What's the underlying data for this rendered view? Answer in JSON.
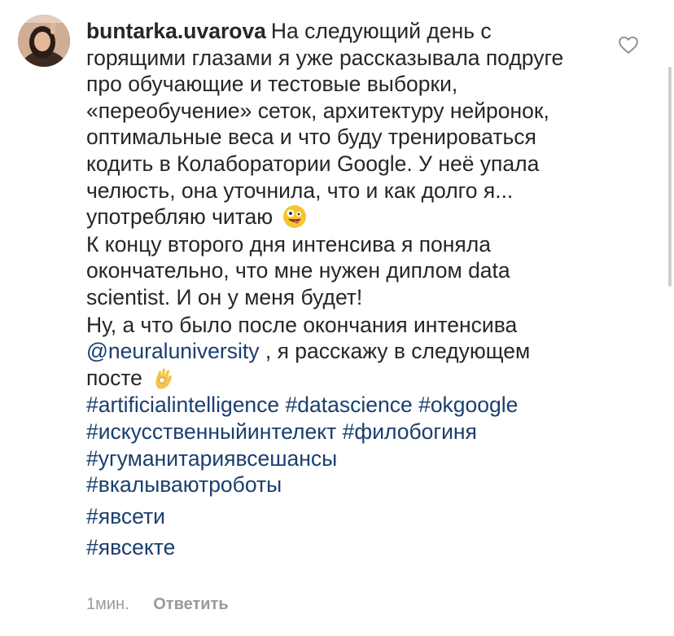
{
  "comment": {
    "username": "buntarka.uvarova",
    "paragraph1": "На следующий день с горящими глазами я уже рассказывала подруге про обучающие и тестовые выборки, «переобучение» сеток, архитектуру нейронок, оптимальные веса и что буду тренироваться кодить в Колаборатории Google.  У неё упала челюсть, она уточнила, что и как долго я... употребляю читаю",
    "paragraph1_emoji": "zany-face-emoji",
    "paragraph2": "К концу второго дня интенсива я поняла окончательно, что мне нужен диплом data scientist. И он у меня будет!",
    "paragraph3_before": "Ну, а что было после окончания интенсива",
    "mention": "@neuraluniversity",
    "paragraph3_after": " , я расскажу в следующем посте",
    "paragraph3_emoji": "ok-hand-emoji",
    "hashtags": [
      "#artificialintelligence",
      "#datascience",
      "#okgoogle",
      "#искусственныйинтелект",
      "#филобогиня",
      "#угуманитариявсешансы",
      "#вкалываютроботы",
      "#явсети",
      "#явсекте"
    ]
  },
  "footer": {
    "time": "1мин.",
    "reply_label": "Ответить"
  },
  "icons": {
    "like": "heart-outline-icon"
  },
  "colors": {
    "text": "#262626",
    "link": "#1a3f6e",
    "muted": "#9a9a9a"
  }
}
